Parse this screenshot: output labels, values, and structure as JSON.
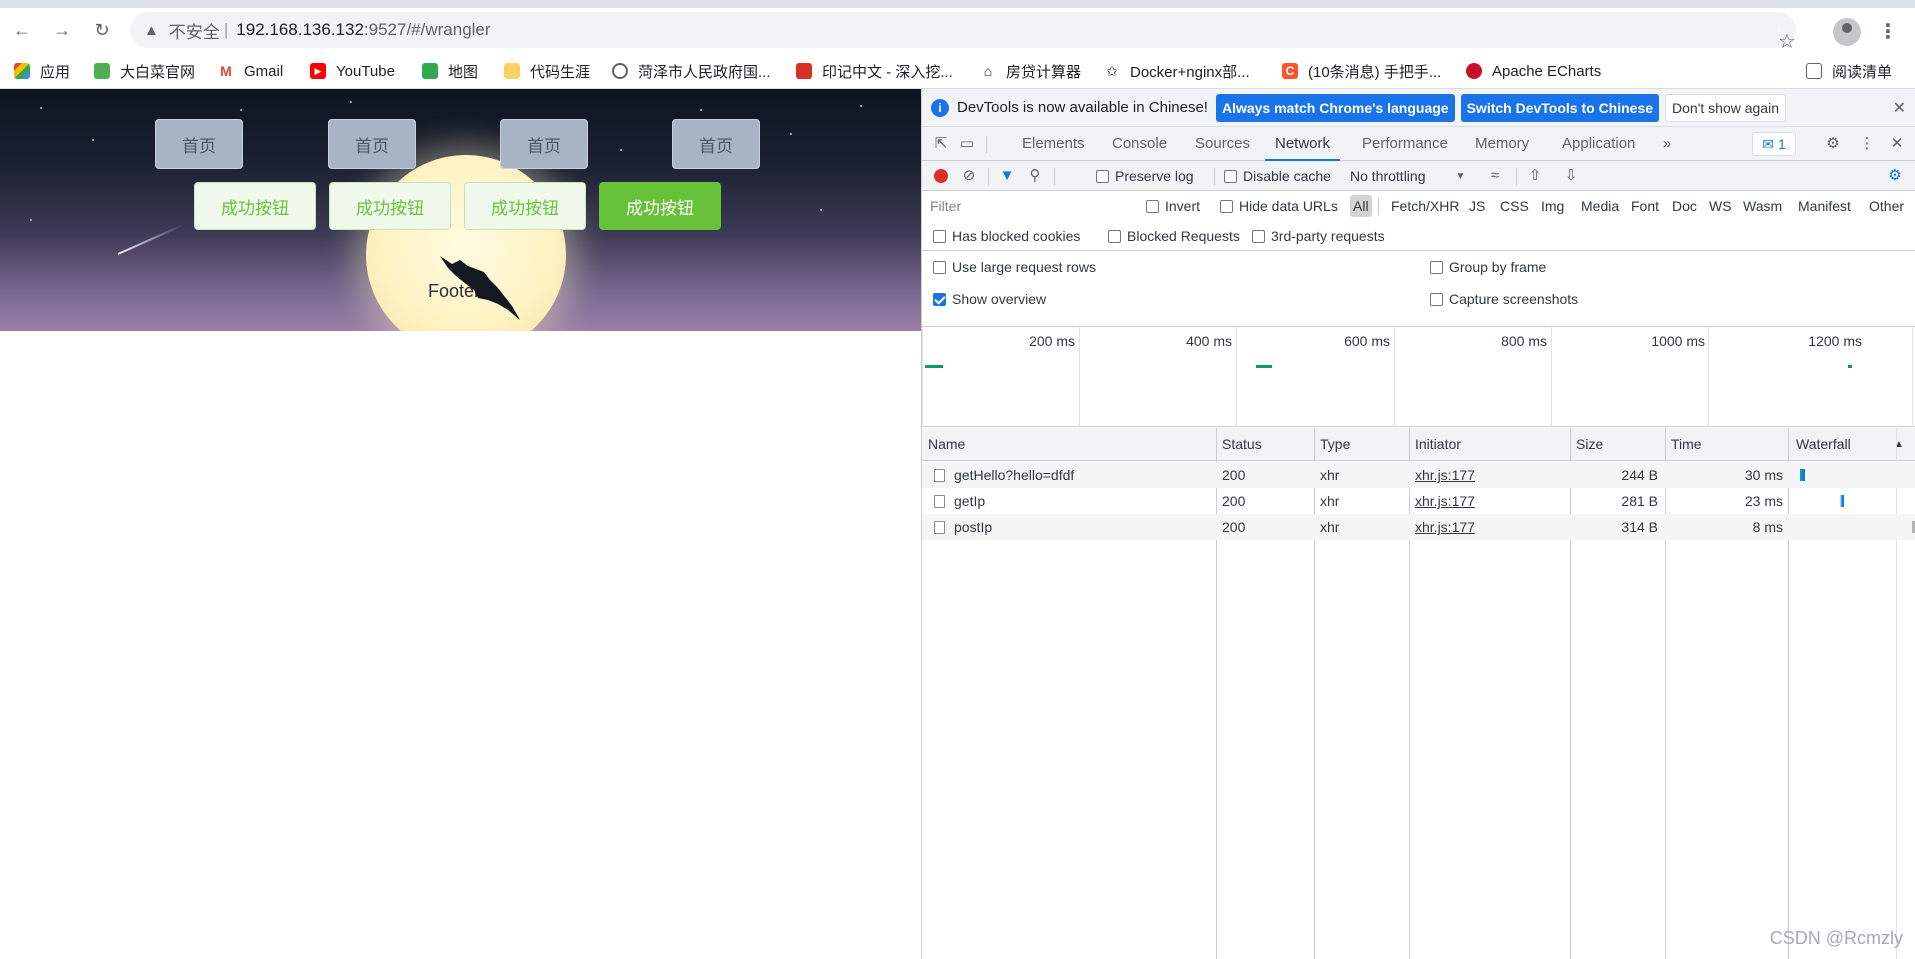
{
  "browser": {
    "url_prefix": "不安全",
    "url_host": "192.168.136.132",
    "url_path": ":9527/#/wrangler",
    "bookmarks": [
      "应用",
      "大白菜官网",
      "Gmail",
      "YouTube",
      "地图",
      "代码生涯",
      "菏泽市人民政府国...",
      "印记中文 - 深入挖...",
      "房贷计算器",
      "Docker+nginx部...",
      "(10条消息) 手把手...",
      "Apache ECharts"
    ],
    "reading_list": "阅读清单"
  },
  "page": {
    "plain_buttons": [
      "首页",
      "首页",
      "首页",
      "首页"
    ],
    "success_buttons": [
      "成功按钮",
      "成功按钮",
      "成功按钮",
      "成功按钮"
    ],
    "footer": "Footer"
  },
  "devtools": {
    "infobar": {
      "message": "DevTools is now available in Chinese!",
      "btn_match": "Always match Chrome's language",
      "btn_switch": "Switch DevTools to Chinese",
      "btn_dont": "Don't show again"
    },
    "tabs": [
      "Elements",
      "Console",
      "Sources",
      "Network",
      "Performance",
      "Memory",
      "Application"
    ],
    "issues_count": "1",
    "netbar": {
      "preserve_log": "Preserve log",
      "disable_cache": "Disable cache",
      "throttling": "No throttling"
    },
    "filter": {
      "placeholder": "Filter",
      "invert": "Invert",
      "hide_data_urls": "Hide data URLs",
      "types": [
        "All",
        "Fetch/XHR",
        "JS",
        "CSS",
        "Img",
        "Media",
        "Font",
        "Doc",
        "WS",
        "Wasm",
        "Manifest",
        "Other"
      ]
    },
    "blocked": {
      "has_blocked_cookies": "Has blocked cookies",
      "blocked_requests": "Blocked Requests",
      "third_party": "3rd-party requests"
    },
    "settings": {
      "large_rows": "Use large request rows",
      "group_by_frame": "Group by frame",
      "show_overview": "Show overview",
      "capture_screenshots": "Capture screenshots"
    },
    "overview_ticks": [
      "200 ms",
      "400 ms",
      "600 ms",
      "800 ms",
      "1000 ms",
      "1200 ms"
    ],
    "columns": [
      "Name",
      "Status",
      "Type",
      "Initiator",
      "Size",
      "Time",
      "Waterfall"
    ],
    "rows": [
      {
        "name": "getHello?hello=dfdf",
        "status": "200",
        "type": "xhr",
        "initiator": "xhr.js:177",
        "size": "244 B",
        "time": "30 ms"
      },
      {
        "name": "getIp",
        "status": "200",
        "type": "xhr",
        "initiator": "xhr.js:177",
        "size": "281 B",
        "time": "23 ms"
      },
      {
        "name": "postIp",
        "status": "200",
        "type": "xhr",
        "initiator": "xhr.js:177",
        "size": "314 B",
        "time": "8 ms"
      }
    ]
  },
  "watermark": "CSDN @Rcmzly"
}
